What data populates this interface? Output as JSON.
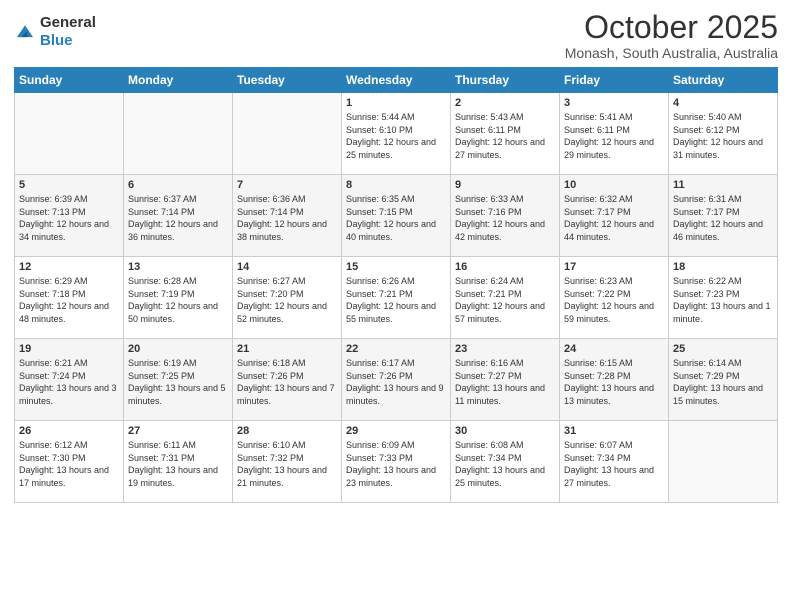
{
  "logo": {
    "general": "General",
    "blue": "Blue"
  },
  "header": {
    "title": "October 2025",
    "location": "Monash, South Australia, Australia"
  },
  "days": [
    "Sunday",
    "Monday",
    "Tuesday",
    "Wednesday",
    "Thursday",
    "Friday",
    "Saturday"
  ],
  "weeks": [
    [
      {
        "day": "",
        "info": ""
      },
      {
        "day": "",
        "info": ""
      },
      {
        "day": "",
        "info": ""
      },
      {
        "day": "1",
        "info": "Sunrise: 5:44 AM\nSunset: 6:10 PM\nDaylight: 12 hours\nand 25 minutes."
      },
      {
        "day": "2",
        "info": "Sunrise: 5:43 AM\nSunset: 6:11 PM\nDaylight: 12 hours\nand 27 minutes."
      },
      {
        "day": "3",
        "info": "Sunrise: 5:41 AM\nSunset: 6:11 PM\nDaylight: 12 hours\nand 29 minutes."
      },
      {
        "day": "4",
        "info": "Sunrise: 5:40 AM\nSunset: 6:12 PM\nDaylight: 12 hours\nand 31 minutes."
      }
    ],
    [
      {
        "day": "5",
        "info": "Sunrise: 6:39 AM\nSunset: 7:13 PM\nDaylight: 12 hours\nand 34 minutes."
      },
      {
        "day": "6",
        "info": "Sunrise: 6:37 AM\nSunset: 7:14 PM\nDaylight: 12 hours\nand 36 minutes."
      },
      {
        "day": "7",
        "info": "Sunrise: 6:36 AM\nSunset: 7:14 PM\nDaylight: 12 hours\nand 38 minutes."
      },
      {
        "day": "8",
        "info": "Sunrise: 6:35 AM\nSunset: 7:15 PM\nDaylight: 12 hours\nand 40 minutes."
      },
      {
        "day": "9",
        "info": "Sunrise: 6:33 AM\nSunset: 7:16 PM\nDaylight: 12 hours\nand 42 minutes."
      },
      {
        "day": "10",
        "info": "Sunrise: 6:32 AM\nSunset: 7:17 PM\nDaylight: 12 hours\nand 44 minutes."
      },
      {
        "day": "11",
        "info": "Sunrise: 6:31 AM\nSunset: 7:17 PM\nDaylight: 12 hours\nand 46 minutes."
      }
    ],
    [
      {
        "day": "12",
        "info": "Sunrise: 6:29 AM\nSunset: 7:18 PM\nDaylight: 12 hours\nand 48 minutes."
      },
      {
        "day": "13",
        "info": "Sunrise: 6:28 AM\nSunset: 7:19 PM\nDaylight: 12 hours\nand 50 minutes."
      },
      {
        "day": "14",
        "info": "Sunrise: 6:27 AM\nSunset: 7:20 PM\nDaylight: 12 hours\nand 52 minutes."
      },
      {
        "day": "15",
        "info": "Sunrise: 6:26 AM\nSunset: 7:21 PM\nDaylight: 12 hours\nand 55 minutes."
      },
      {
        "day": "16",
        "info": "Sunrise: 6:24 AM\nSunset: 7:21 PM\nDaylight: 12 hours\nand 57 minutes."
      },
      {
        "day": "17",
        "info": "Sunrise: 6:23 AM\nSunset: 7:22 PM\nDaylight: 12 hours\nand 59 minutes."
      },
      {
        "day": "18",
        "info": "Sunrise: 6:22 AM\nSunset: 7:23 PM\nDaylight: 13 hours\nand 1 minute."
      }
    ],
    [
      {
        "day": "19",
        "info": "Sunrise: 6:21 AM\nSunset: 7:24 PM\nDaylight: 13 hours\nand 3 minutes."
      },
      {
        "day": "20",
        "info": "Sunrise: 6:19 AM\nSunset: 7:25 PM\nDaylight: 13 hours\nand 5 minutes."
      },
      {
        "day": "21",
        "info": "Sunrise: 6:18 AM\nSunset: 7:26 PM\nDaylight: 13 hours\nand 7 minutes."
      },
      {
        "day": "22",
        "info": "Sunrise: 6:17 AM\nSunset: 7:26 PM\nDaylight: 13 hours\nand 9 minutes."
      },
      {
        "day": "23",
        "info": "Sunrise: 6:16 AM\nSunset: 7:27 PM\nDaylight: 13 hours\nand 11 minutes."
      },
      {
        "day": "24",
        "info": "Sunrise: 6:15 AM\nSunset: 7:28 PM\nDaylight: 13 hours\nand 13 minutes."
      },
      {
        "day": "25",
        "info": "Sunrise: 6:14 AM\nSunset: 7:29 PM\nDaylight: 13 hours\nand 15 minutes."
      }
    ],
    [
      {
        "day": "26",
        "info": "Sunrise: 6:12 AM\nSunset: 7:30 PM\nDaylight: 13 hours\nand 17 minutes."
      },
      {
        "day": "27",
        "info": "Sunrise: 6:11 AM\nSunset: 7:31 PM\nDaylight: 13 hours\nand 19 minutes."
      },
      {
        "day": "28",
        "info": "Sunrise: 6:10 AM\nSunset: 7:32 PM\nDaylight: 13 hours\nand 21 minutes."
      },
      {
        "day": "29",
        "info": "Sunrise: 6:09 AM\nSunset: 7:33 PM\nDaylight: 13 hours\nand 23 minutes."
      },
      {
        "day": "30",
        "info": "Sunrise: 6:08 AM\nSunset: 7:34 PM\nDaylight: 13 hours\nand 25 minutes."
      },
      {
        "day": "31",
        "info": "Sunrise: 6:07 AM\nSunset: 7:34 PM\nDaylight: 13 hours\nand 27 minutes."
      },
      {
        "day": "",
        "info": ""
      }
    ]
  ]
}
